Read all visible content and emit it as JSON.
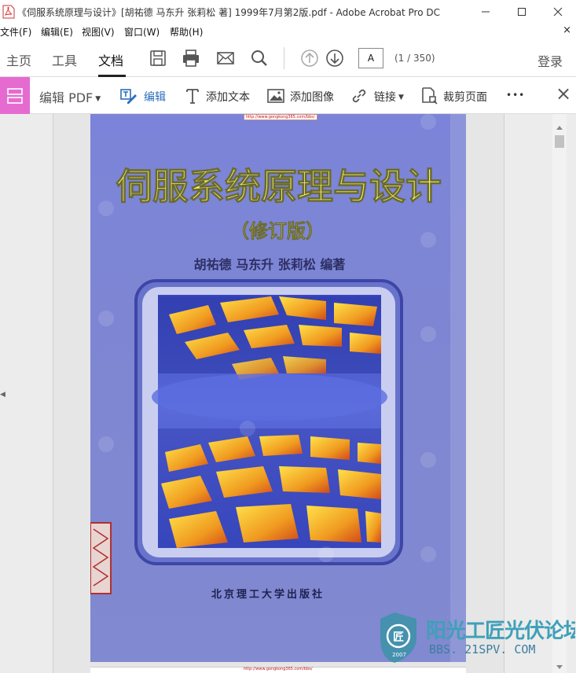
{
  "window": {
    "title": "《伺服系统原理与设计》[胡祐德 马东升 张莉松 著] 1999年7月第2版.pdf - Adobe Acrobat Pro DC"
  },
  "menu": {
    "items": [
      "文件(F)",
      "编辑(E)",
      "视图(V)",
      "窗口(W)",
      "帮助(H)"
    ],
    "close": "×"
  },
  "toolbar": {
    "tabs": [
      "主页",
      "工具",
      "文档"
    ],
    "page_input": "A",
    "page_count": "(1 / 350)",
    "login": "登录",
    "icons": [
      "save-icon",
      "print-icon",
      "mail-icon",
      "search-icon",
      "prev-page-icon",
      "next-page-icon"
    ]
  },
  "edit_toolbar": {
    "edit_pdf": "编辑 PDF",
    "edit": "编辑",
    "add_text": "添加文本",
    "add_image": "添加图像",
    "link": "链接",
    "crop": "裁剪页面",
    "more": "•••",
    "close": "×"
  },
  "document": {
    "url_top": "http://www.gongkong365.com/bbs/",
    "book_title": "伺服系统原理与设计",
    "edition": "（修订版）",
    "authors": "胡祐德  马东升  张莉松  编著",
    "publisher": "北京理工大学出版社",
    "url_bottom": "http://www.gongkong365.com/bbs/"
  },
  "watermark": {
    "name": "阳光工匠光伏论坛",
    "url": "BBS. 21SPV. COM",
    "year": "2007"
  },
  "colors": {
    "accent_blue": "#2a6ebb",
    "edit_pane_pink": "#e66bd0",
    "cover_blue": "#7c86d6",
    "title_yellow": "#f3ef6a"
  }
}
